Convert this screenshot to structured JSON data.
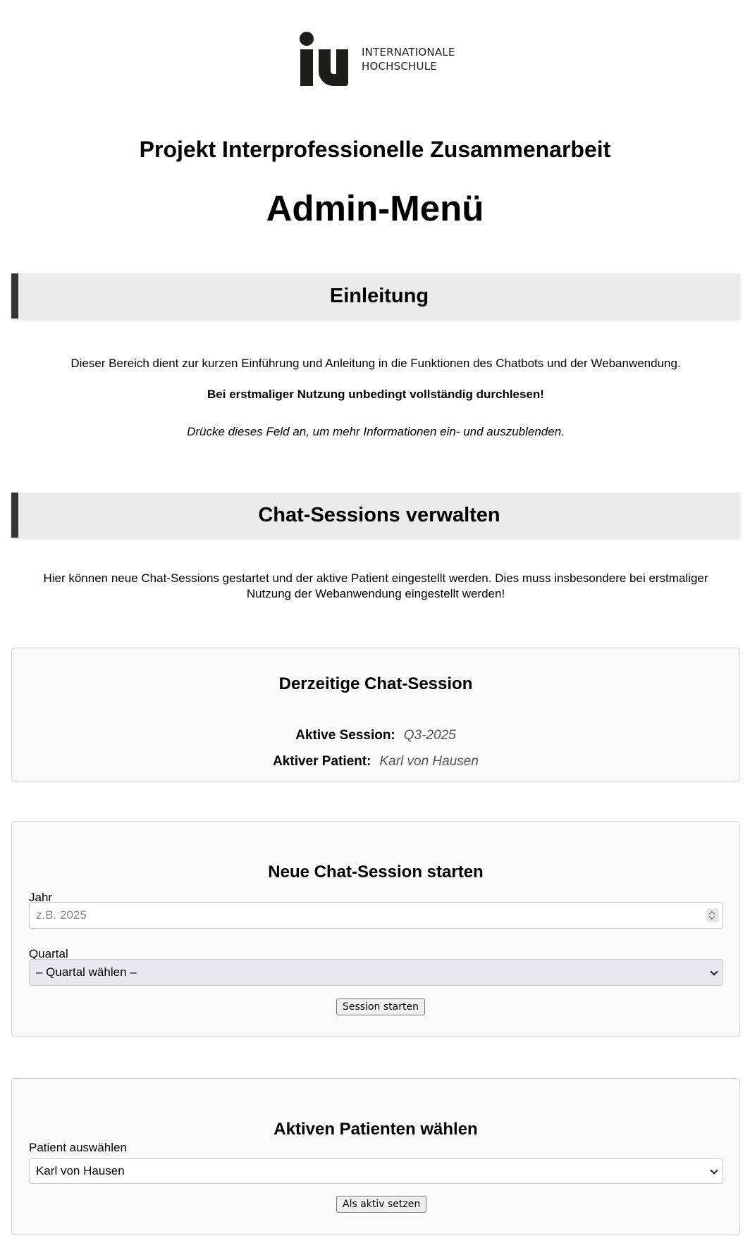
{
  "logo": {
    "mark": "iu",
    "line1": "INTERNATIONALE",
    "line2": "HOCHSCHULE"
  },
  "project_title": "Projekt Interprofessionelle Zusammenarbeit",
  "page_title": "Admin-Menü",
  "intro": {
    "heading": "Einleitung",
    "text": "Dieser Bereich dient zur kurzen Einführung und Anleitung in die Funktionen des Chatbots und der Webanwendung.",
    "warning": "Bei erstmaliger Nutzung unbedingt vollständig durchlesen!",
    "hint": "Drücke dieses Feld an, um mehr Informationen ein- und auszublenden."
  },
  "chat_sessions": {
    "heading": "Chat-Sessions verwalten",
    "text": "Hier können neue Chat-Sessions gestartet und der aktive Patient eingestellt werden. Dies muss insbesondere bei erstmaliger Nutzung der Webanwendung eingestellt werden!"
  },
  "current_session": {
    "title": "Derzeitige Chat-Session",
    "session_label": "Aktive Session:",
    "session_value": "Q3-2025",
    "patient_label": "Aktiver Patient:",
    "patient_value": "Karl von Hausen"
  },
  "new_session": {
    "title": "Neue Chat-Session starten",
    "year_label": "Jahr",
    "year_placeholder": "z.B. 2025",
    "year_value": "",
    "quarter_label": "Quartal",
    "quarter_selected": "– Quartal wählen –",
    "button": "Session starten"
  },
  "patient_select": {
    "title": "Aktiven Patienten wählen",
    "label": "Patient auswählen",
    "selected": "Karl von Hausen",
    "button": "Als aktiv setzen"
  },
  "colors": {
    "section_bg": "#ebebeb",
    "section_accent": "#333333",
    "card_bg": "#fafafa",
    "card_border": "#cfcfcf"
  }
}
